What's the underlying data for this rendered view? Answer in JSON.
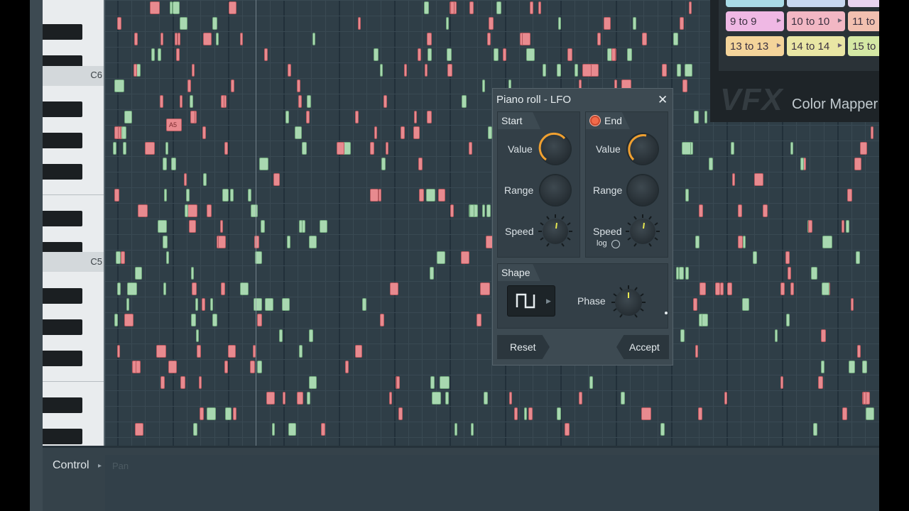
{
  "window": {
    "title": "Piano roll - LFO",
    "close_glyph": "✕"
  },
  "keyboard": {
    "labels": [
      "C6",
      "C5"
    ]
  },
  "note_labels": [
    "A5"
  ],
  "control": {
    "label": "Control",
    "param": "Pan"
  },
  "mapper": {
    "buttons": [
      "9 to 9",
      "10 to 10",
      "11 to",
      "13 to 13",
      "14 to 14",
      "15 to"
    ],
    "brand": "VFX",
    "name": "Color Mapper"
  },
  "lfo": {
    "start": {
      "title": "Start",
      "value_label": "Value",
      "range_label": "Range",
      "speed_label": "Speed"
    },
    "end": {
      "title": "End",
      "value_label": "Value",
      "range_label": "Range",
      "speed_label": "Speed",
      "log_label": "log"
    },
    "shape": {
      "title": "Shape",
      "phase_label": "Phase",
      "waveform_icon": "square-wave-icon"
    },
    "reset_label": "Reset",
    "accept_label": "Accept"
  },
  "colors": {
    "accent": "#f0a030",
    "note_red": "#e88a8f",
    "note_green": "#a8d8b0",
    "grid_bg": "#2f3e47"
  }
}
